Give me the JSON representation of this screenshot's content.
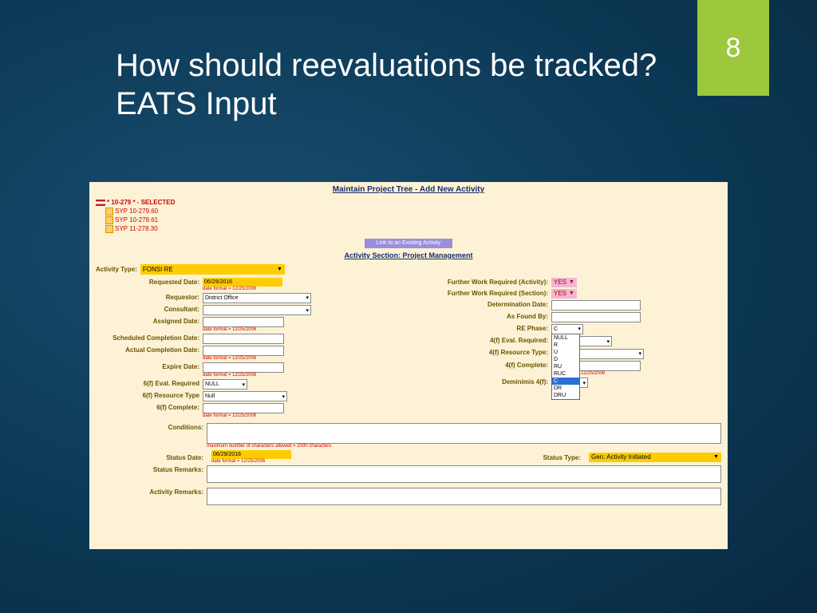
{
  "slide": {
    "number": "8",
    "title": "How should reevaluations be tracked?  EATS Input"
  },
  "form": {
    "header": "Maintain Project Tree - Add New Activity",
    "tree": {
      "selected": "* 10-279 * - SELECTED",
      "items": [
        "SYP 10-279.60",
        "SYP 10-279.61",
        "SYP 11-278.30"
      ]
    },
    "linkButton": "Link to an Existing Activity",
    "sectionTitle": "Activity Section: Project Management",
    "activityType": {
      "label": "Activity Type:",
      "value": "FONSI RE"
    },
    "left": {
      "requestedDate": {
        "label": "Requested Date:",
        "value": "06/29/2016",
        "hint": "date format = 12/25/2006"
      },
      "requestor": {
        "label": "Requestor:",
        "value": "District Office"
      },
      "consultant": {
        "label": "Consultant:"
      },
      "assignedDate": {
        "label": "Assigned Date:",
        "hint": "date format = 12/25/2006"
      },
      "scheduledCompletion": {
        "label": "Scheduled Completion Date:"
      },
      "actualCompletion": {
        "label": "Actual Completion Date:",
        "hint": "date format = 12/25/2006"
      },
      "expireDate": {
        "label": "Expire Date:",
        "hint": "date format = 12/25/2006"
      },
      "eval6f": {
        "label": "6(f) Eval. Required",
        "value": "NULL"
      },
      "res6f": {
        "label": "6(f) Resource Type",
        "value": "Null"
      },
      "comp6f": {
        "label": "6(f) Complete:",
        "hint": "date format = 12/25/2006"
      }
    },
    "right": {
      "fwActivity": {
        "label": "Further Work Required (Activity):",
        "value": "YES"
      },
      "fwSection": {
        "label": "Further Work Required (Section):",
        "value": "YES"
      },
      "detDate": {
        "label": "Determination Date:"
      },
      "asFoundBy": {
        "label": "As Found By:"
      },
      "rePhase": {
        "label": "RE Phase:",
        "value": "C",
        "options": [
          "NULL",
          "R",
          "U",
          "D",
          "RU",
          "RUC",
          "C",
          "DR",
          "DRU"
        ]
      },
      "eval4f": {
        "label": "4(f) Eval. Required:"
      },
      "res4f": {
        "label": "4(f) Resource Type:"
      },
      "comp4f": {
        "label": "4(f) Complete:",
        "hint": "date format = 12/25/2006"
      },
      "demin4f": {
        "label": "Deminimis 4(f):"
      }
    },
    "bottom": {
      "conditions": {
        "label": "Conditions:",
        "hint": "maximum number of characters allowed = 2000 characters"
      },
      "statusDate": {
        "label": "Status Date:",
        "value": "06/29/2016",
        "hint": "date format = 12/25/2006"
      },
      "statusType": {
        "label": "Status Type:",
        "value": "Gen: Activity Initiated"
      },
      "statusRemarks": {
        "label": "Status Remarks:"
      },
      "activityRemarks": {
        "label": "Activity Remarks:"
      }
    }
  }
}
